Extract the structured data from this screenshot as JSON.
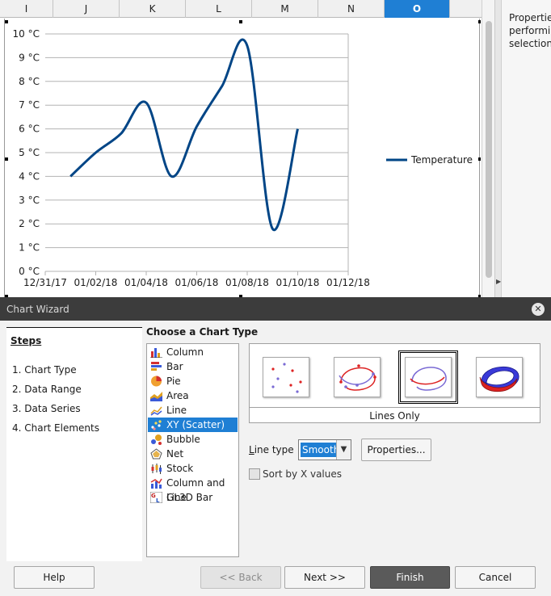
{
  "spreadsheet": {
    "columns": [
      {
        "name": "I",
        "selected": false
      },
      {
        "name": "J",
        "selected": false
      },
      {
        "name": "K",
        "selected": false
      },
      {
        "name": "L",
        "selected": false
      },
      {
        "name": "M",
        "selected": false
      },
      {
        "name": "N",
        "selected": false
      },
      {
        "name": "O",
        "selected": true
      }
    ]
  },
  "sidebar": {
    "lines": [
      "Properties",
      "performing",
      "selection"
    ]
  },
  "chart_data": {
    "type": "line",
    "smooth": true,
    "series": [
      {
        "name": "Temperature",
        "color": "#004586",
        "x": [
          "01/01/18",
          "01/02/18",
          "01/03/18",
          "01/04/18",
          "01/05/18",
          "01/06/18",
          "01/07/18",
          "01/08/18",
          "01/09/18",
          "01/10/18"
        ],
        "y": [
          4,
          5,
          5.8,
          7.1,
          4,
          6.1,
          7.8,
          9.5,
          1.8,
          6
        ]
      }
    ],
    "x_ticks": [
      "12/31/17",
      "01/02/18",
      "01/04/18",
      "01/06/18",
      "01/08/18",
      "01/10/18",
      "01/12/18"
    ],
    "y_ticks": [
      "0 °C",
      "1 °C",
      "2 °C",
      "3 °C",
      "4 °C",
      "5 °C",
      "6 °C",
      "7 °C",
      "8 °C",
      "9 °C",
      "10 °C"
    ],
    "xlim": [
      "12/31/17",
      "01/12/18"
    ],
    "ylim": [
      0,
      10
    ],
    "grid": true,
    "legend": "right",
    "grid_color": "#b3b3b3"
  },
  "dialog": {
    "title": "Chart Wizard",
    "close_glyph": "✕",
    "steps_title": "Steps",
    "steps": [
      {
        "label": "1. Chart Type",
        "active": true
      },
      {
        "label": "2. Data Range",
        "active": false
      },
      {
        "label": "3. Data Series",
        "active": false
      },
      {
        "label": "4. Chart Elements",
        "active": false
      }
    ],
    "choose_title": "Choose a Chart Type",
    "chart_types": [
      {
        "label": "Column",
        "icon": "column-chart-icon",
        "selected": false
      },
      {
        "label": "Bar",
        "icon": "bar-chart-icon",
        "selected": false
      },
      {
        "label": "Pie",
        "icon": "pie-chart-icon",
        "selected": false
      },
      {
        "label": "Area",
        "icon": "area-chart-icon",
        "selected": false
      },
      {
        "label": "Line",
        "icon": "line-chart-icon",
        "selected": false
      },
      {
        "label": "XY (Scatter)",
        "icon": "scatter-chart-icon",
        "selected": true
      },
      {
        "label": "Bubble",
        "icon": "bubble-chart-icon",
        "selected": false
      },
      {
        "label": "Net",
        "icon": "net-chart-icon",
        "selected": false
      },
      {
        "label": "Stock",
        "icon": "stock-chart-icon",
        "selected": false
      },
      {
        "label": "Column and Line",
        "icon": "column-and-line-chart-icon",
        "selected": false
      },
      {
        "label": "GL3D Bar",
        "icon": "gl3d-bar-chart-icon",
        "selected": false
      }
    ],
    "variants": [
      {
        "icon": "points-only-icon",
        "selected": false
      },
      {
        "icon": "points-and-lines-icon",
        "selected": false
      },
      {
        "icon": "lines-only-icon",
        "selected": true
      },
      {
        "icon": "3d-lines-icon",
        "selected": false
      }
    ],
    "variant_caption": "Lines Only",
    "line_type_label_ul": "L",
    "line_type_label_rest": "ine type",
    "line_type_value": "Smooth",
    "properties_label": "Properties...",
    "sort_label": "Sort by X values",
    "sort_checked": false,
    "buttons": {
      "help": "Help",
      "back": "<< Back",
      "next": "Next >>",
      "finish": "Finish",
      "cancel": "Cancel"
    }
  }
}
